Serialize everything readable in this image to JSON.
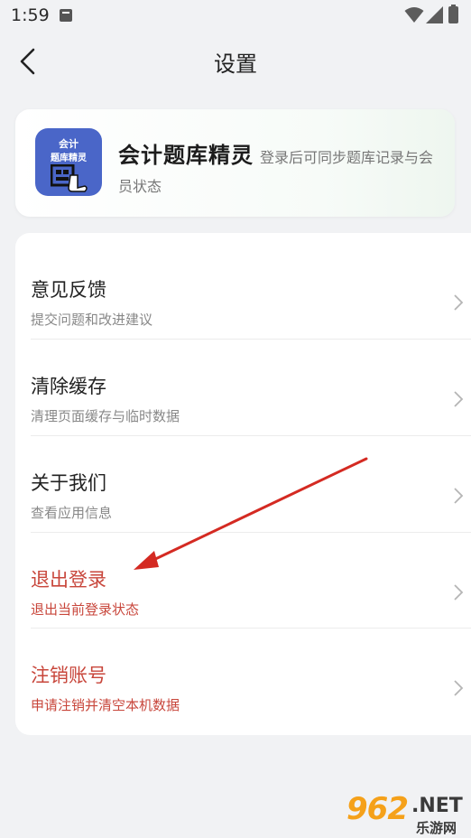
{
  "status_bar": {
    "time": "1:59"
  },
  "header": {
    "title": "设置",
    "back_icon": "chevron-left-icon"
  },
  "app_card": {
    "logo_line1": "会计",
    "logo_line2": "题库精灵",
    "name": "会计题库精灵",
    "description": "登录后可同步题库记录与会员状态",
    "logo_color": "#4a66c8"
  },
  "settings": {
    "items": [
      {
        "title": "意见反馈",
        "subtitle": "提交问题和改进建议"
      },
      {
        "title": "清除缓存",
        "subtitle": "清理页面缓存与临时数据"
      },
      {
        "title": "关于我们",
        "subtitle": "查看应用信息"
      },
      {
        "title": "退出登录",
        "subtitle": "退出当前登录状态"
      },
      {
        "title": "注销账号",
        "subtitle": "申请注销并清空本机数据"
      }
    ],
    "danger_color": "#c8463b"
  },
  "watermark": {
    "number": "962",
    "domain": ".NET",
    "chinese": "乐游网"
  }
}
